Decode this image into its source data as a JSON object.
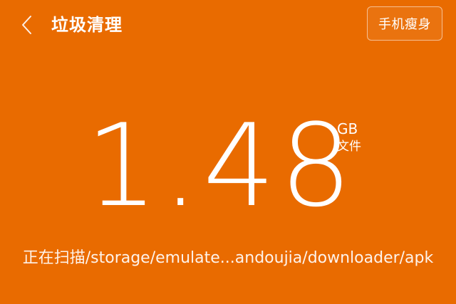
{
  "header": {
    "title": "垃圾清理",
    "back_icon": "chevron-left-icon",
    "slim_button_label": "手机瘦身"
  },
  "summary": {
    "size_value": "1.48",
    "unit": "GB",
    "unit_sub": "文件"
  },
  "status": {
    "scan_text": "正在扫描/storage/emulate...andoujia/downloader/apk"
  },
  "colors": {
    "background": "#e96b00",
    "text": "#ffffff"
  }
}
